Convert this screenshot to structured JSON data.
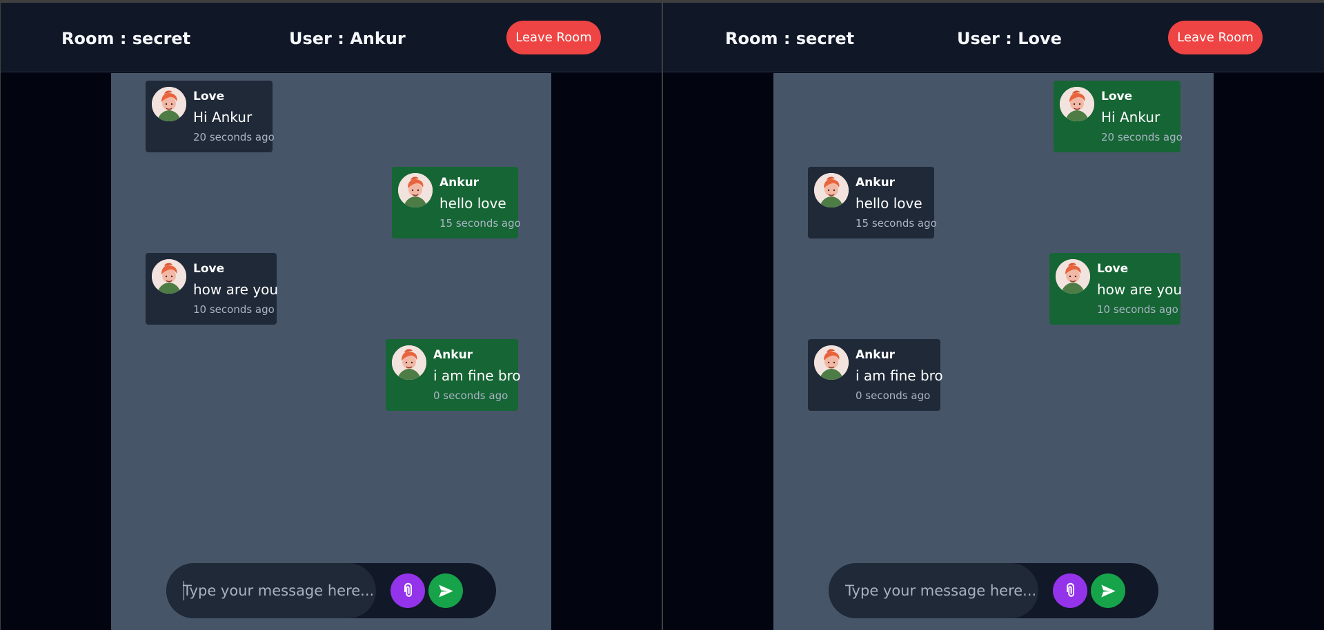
{
  "panes": [
    {
      "room_label": "Room : secret",
      "user_label": "User : Ankur",
      "leave_button": "Leave Room",
      "composer": {
        "placeholder": "Type your message here...",
        "attach_icon": "paperclip-icon",
        "send_icon": "send-icon"
      },
      "messages": [
        {
          "sender": "Love",
          "text": "Hi Ankur",
          "time": "20 seconds ago",
          "style": "dark"
        },
        {
          "sender": "Ankur",
          "text": "hello love",
          "time": "15 seconds ago",
          "style": "green"
        },
        {
          "sender": "Love",
          "text": "how are you",
          "time": "10 seconds ago",
          "style": "dark"
        },
        {
          "sender": "Ankur",
          "text": "i am fine bro",
          "time": "0 seconds ago",
          "style": "green"
        }
      ]
    },
    {
      "room_label": "Room : secret",
      "user_label": "User : Love",
      "leave_button": "Leave Room",
      "composer": {
        "placeholder": "Type your message here...",
        "attach_icon": "paperclip-icon",
        "send_icon": "send-icon"
      },
      "messages": [
        {
          "sender": "Love",
          "text": "Hi Ankur",
          "time": "20 seconds ago",
          "style": "green"
        },
        {
          "sender": "Ankur",
          "text": "hello love",
          "time": "15 seconds ago",
          "style": "dark"
        },
        {
          "sender": "Love",
          "text": "how are you",
          "time": "10 seconds ago",
          "style": "green"
        },
        {
          "sender": "Ankur",
          "text": "i am fine bro",
          "time": "0 seconds ago",
          "style": "dark"
        }
      ]
    }
  ],
  "colors": {
    "header": "#101828",
    "chat_background": "#475569",
    "incoming_bubble": "#1f2937",
    "outgoing_bubble": "#166534",
    "leave_button": "#ef4444",
    "attach_button": "#9333ea",
    "send_button": "#16a34a"
  }
}
